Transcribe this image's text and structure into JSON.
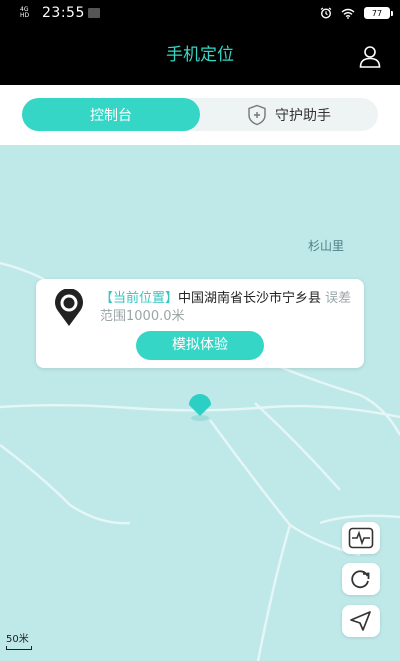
{
  "status_bar": {
    "network_label": "4G HD",
    "time": "23:55",
    "battery": "77"
  },
  "header": {
    "title": "手机定位"
  },
  "tabs": [
    {
      "label": "控制台",
      "active": true
    },
    {
      "label": "守护助手",
      "active": false
    }
  ],
  "map": {
    "place_label": "杉山里",
    "scale_label": "50米"
  },
  "location_card": {
    "label": "【当前位置】",
    "address": "中国湖南省长沙市宁乡县",
    "accuracy": "误差范围1000.0米",
    "button_label": "模拟体验"
  },
  "colors": {
    "accent": "#36d6c6",
    "map_background": "#bfe9e9",
    "header_background": "#000000"
  },
  "icons": {
    "profile": "person-outline-icon",
    "shield": "shield-plus-icon",
    "location_pin": "location-pin-icon",
    "map_marker": "map-marker-icon",
    "pulse": "heart-pulse-icon",
    "refresh": "refresh-icon",
    "navigate": "navigation-arrow-icon"
  }
}
